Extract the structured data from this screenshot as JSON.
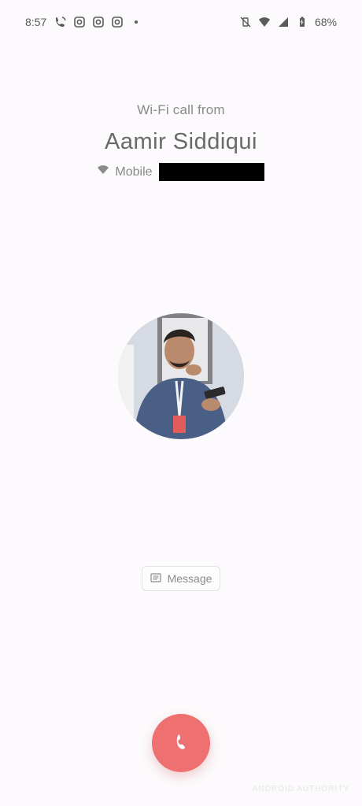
{
  "status_bar": {
    "time": "8:57",
    "battery": "68%",
    "left_icons": [
      "wifi-call-icon",
      "instagram-icon",
      "instagram-icon",
      "instagram-icon",
      "dot-icon"
    ],
    "right_icons": [
      "vibrate-off-icon",
      "wifi-icon",
      "cell-signal-icon",
      "battery-icon"
    ]
  },
  "call": {
    "type_label": "Wi-Fi call from",
    "caller_name": "Aamir Siddiqui",
    "line_label": "Mobile"
  },
  "actions": {
    "message_label": "Message",
    "end_call_icon": "phone-hangup-icon"
  },
  "watermark": "ANDROID AUTHORITY",
  "colors": {
    "background": "#fcfafc",
    "end_call": "#ee7070"
  }
}
